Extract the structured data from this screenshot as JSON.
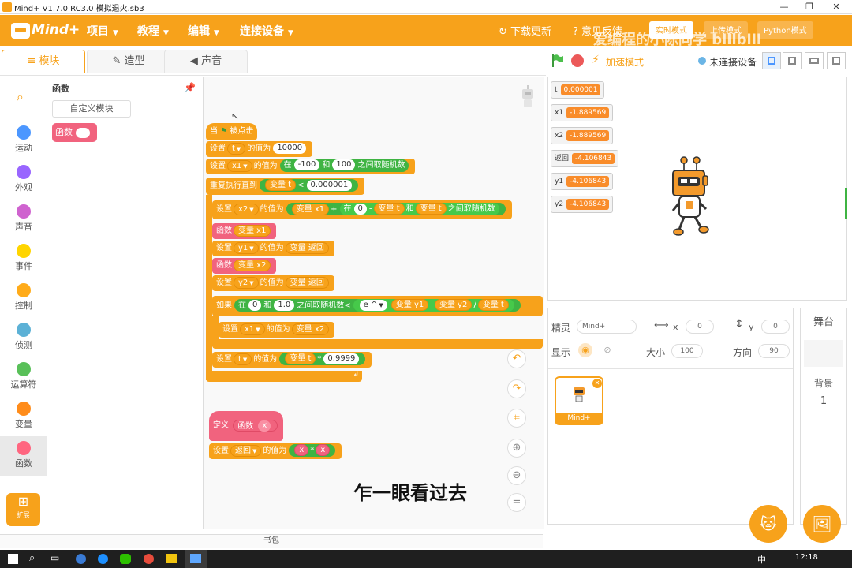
{
  "window": {
    "title": "Mind+ V1.7.0 RC3.0   模拟退火.sb3",
    "min": "—",
    "max": "❐",
    "close": "✕"
  },
  "menu": {
    "logo": "Mind+",
    "items": [
      "项目",
      "教程",
      "编辑",
      "连接设备"
    ],
    "caret": "▼",
    "download": "下载更新",
    "feedback": "意见反馈",
    "mode_realtime": "实时模式",
    "mode_upload": "上传模式",
    "mode_python": "Python模式",
    "watermark": "爱编程的小陈同学  bilibili"
  },
  "tabs": {
    "blocks": "模块",
    "costumes": "造型",
    "sounds": "声音"
  },
  "stage_header": {
    "turbo": "加速模式",
    "device": "未连接设备"
  },
  "categories": [
    {
      "label": "运动",
      "color": "#4c97ff"
    },
    {
      "label": "外观",
      "color": "#9966ff"
    },
    {
      "label": "声音",
      "color": "#cf63cf"
    },
    {
      "label": "事件",
      "color": "#ffd500"
    },
    {
      "label": "控制",
      "color": "#ffab19"
    },
    {
      "label": "侦测",
      "color": "#5cb1d6"
    },
    {
      "label": "运算符",
      "color": "#59c059"
    },
    {
      "label": "变量",
      "color": "#ff8c1a"
    },
    {
      "label": "函数",
      "color": "#ff6680"
    }
  ],
  "extension_label": "扩展",
  "palette": {
    "title": "函数",
    "custom_block": "自定义模块",
    "func_block": "函数"
  },
  "script": {
    "hat": "当",
    "hat_after": "被点击",
    "set": "设置",
    "value_of": "的值为",
    "var_t": "t",
    "val_10000": "10000",
    "var_x1": "x1",
    "in": "在",
    "and": "和",
    "between_random": "之间取随机数",
    "n_neg100": "-100",
    "n_100": "100",
    "repeat_until": "重复执行直到",
    "var_t_rep": "变量 t",
    "lt": "<",
    "val_small": "0.000001",
    "var_x2": "x2",
    "var_x1_rep": "变量 x1",
    "plus": "+",
    "minus": "-",
    "n_0": "0",
    "func": "函数",
    "var_y1": "y1",
    "var_ret": "变量 返回",
    "var_x2_rep": "变量 x2",
    "var_y2": "y2",
    "if": "如果",
    "n_zero": "0",
    "n_one": "1.0",
    "e_pow": "e ^",
    "var_y1_rep": "变量 y1",
    "var_y2_rep": "变量 y2",
    "div": "/",
    "times": "*",
    "val_rate": "0.9999",
    "define": "定义",
    "func_name": "函数",
    "param_x": "x",
    "var_return": "返回"
  },
  "monitors": [
    {
      "name": "t",
      "value": "0.000001"
    },
    {
      "name": "x1",
      "value": "-1.889569"
    },
    {
      "name": "x2",
      "value": "-1.889569"
    },
    {
      "name": "返回",
      "value": "-4.106843"
    },
    {
      "name": "y1",
      "value": "-4.106843"
    },
    {
      "name": "y2",
      "value": "-4.106843"
    }
  ],
  "sprite_info": {
    "sprite_label": "精灵",
    "sprite_name": "Mind+",
    "x_label": "x",
    "x_value": "0",
    "y_label": "y",
    "y_value": "0",
    "show_label": "显示",
    "size_label": "大小",
    "size_value": "100",
    "dir_label": "方向",
    "dir_value": "90",
    "thumb_name": "Mind+"
  },
  "stage_panel": {
    "title": "舞台",
    "backdrop_label": "背景",
    "backdrop_count": "1"
  },
  "backpack": "书包",
  "subtitle": "乍一眼看过去",
  "taskbar": {
    "clock": "12:18",
    "lang": "中"
  }
}
